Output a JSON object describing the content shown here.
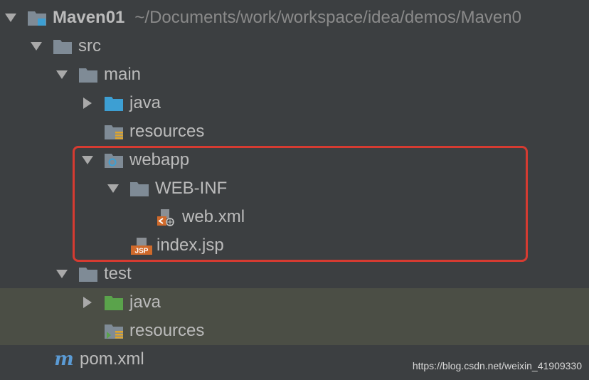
{
  "root": {
    "label": "Maven01",
    "path": "~/Documents/work/workspace/idea/demos/Maven0"
  },
  "tree": {
    "src": "src",
    "main": "main",
    "main_java": "java",
    "main_resources": "resources",
    "webapp": "webapp",
    "webinf": "WEB-INF",
    "webxml": "web.xml",
    "indexjsp": "index.jsp",
    "test": "test",
    "test_java": "java",
    "test_resources": "resources",
    "pom": "pom.xml"
  },
  "icons": {
    "jsp_badge": "JSP",
    "maven_m": "m"
  },
  "watermark": "https://blog.csdn.net/weixin_41909330",
  "colors": {
    "background": "#3c3f41",
    "highlight": "#4b4e45",
    "folder": "#7f8b96",
    "source_folder": "#3d9fd3",
    "test_folder": "#5aa34b",
    "annotation_box": "#d63b31"
  }
}
